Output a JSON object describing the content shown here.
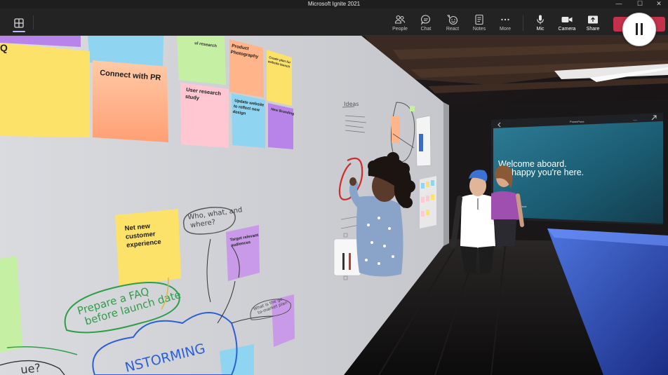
{
  "window": {
    "title": "Microsoft Ignite 2021",
    "controls": [
      "—",
      "☐",
      "✕"
    ]
  },
  "toolbar": {
    "items": [
      {
        "label": "People",
        "icon": "people-icon"
      },
      {
        "label": "Chat",
        "icon": "chat-icon"
      },
      {
        "label": "React",
        "icon": "react-icon"
      },
      {
        "label": "Notes",
        "icon": "notes-icon"
      },
      {
        "label": "More",
        "icon": "more-icon"
      },
      {
        "label": "Mic",
        "icon": "mic-icon"
      },
      {
        "label": "Camera",
        "icon": "camera-icon"
      },
      {
        "label": "Share",
        "icon": "share-icon"
      }
    ],
    "leave_color": "#c4314b"
  },
  "whiteboard": {
    "notes": {
      "q_fragment": "Q",
      "connect_pr": "Connect with PR",
      "research_fragment": "ul research",
      "product_photography": [
        "Product",
        "Photography"
      ],
      "create_plan": [
        "Create plan for",
        "website launch"
      ],
      "user_research": [
        "User research",
        "study"
      ],
      "update_website": [
        "Update website",
        "to reflect new",
        "design"
      ],
      "new_branding": [
        "New Branding"
      ],
      "net_new": [
        "Net new",
        "customer",
        "experience"
      ],
      "target_audiences": [
        "Target relevant",
        "audiences"
      ]
    },
    "handwriting": {
      "who_what_where": [
        "Who, what, and",
        "where?"
      ],
      "prepare_faq": [
        "Prepare a FAQ",
        "before launch date"
      ],
      "brainstorming_fragment": "NSTORMING",
      "what_is_go_plan": [
        "What is the go",
        "to-market plan"
      ],
      "ideas": "Ideas",
      "ue_fragment": "ue?"
    }
  },
  "presentation": {
    "app": "PowerPoint",
    "menu": "...",
    "headline": [
      "Welcome aboard.",
      "We're happy you're here."
    ],
    "headline_visible": [
      "Welcome aboard.",
      "'re happy you're here."
    ],
    "sub_label": "...erience"
  }
}
